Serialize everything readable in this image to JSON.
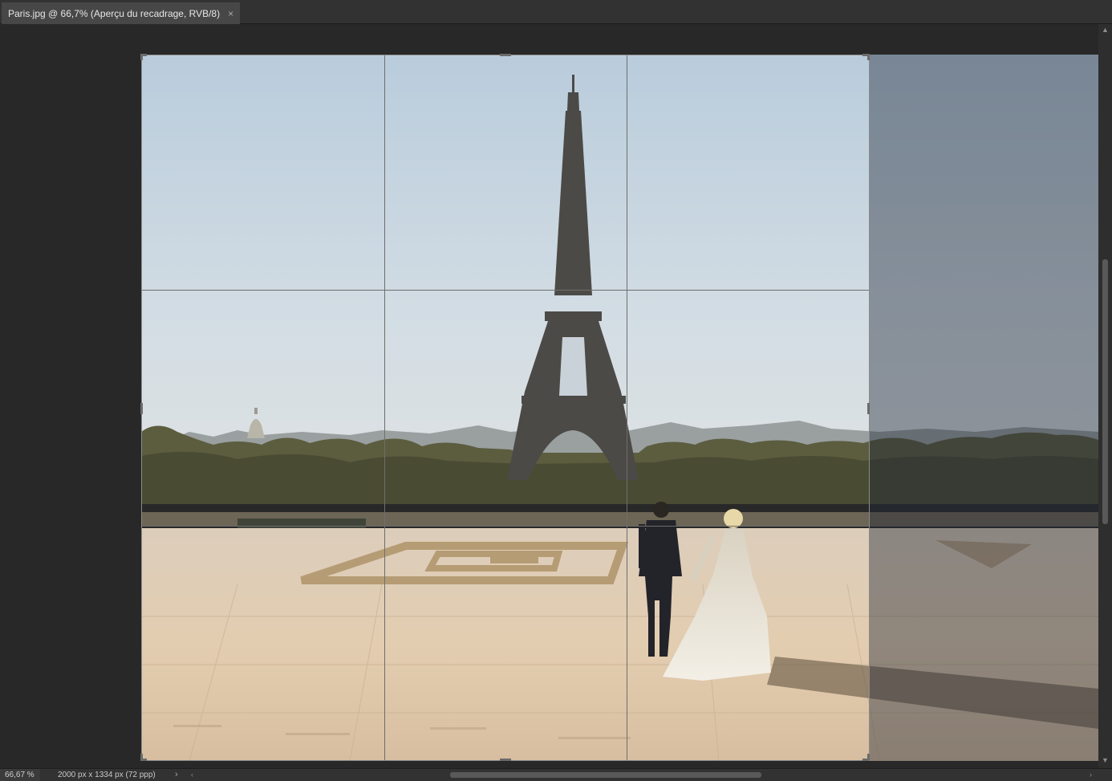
{
  "document_tab": {
    "title": "Paris.jpg @ 66,7% (Aperçu du recadrage, RVB/8)",
    "close_glyph": "×"
  },
  "status": {
    "zoom": "66,67 %",
    "doc_info": "2000 px x 1334 px (72 ppp)",
    "info_arrow": "›"
  },
  "scrollbars": {
    "up_arrow": "▲",
    "down_arrow": "▼",
    "left_arrow": "‹",
    "right_arrow": "›"
  },
  "colors": {
    "app_background": "#282828",
    "tab_active": "#474747",
    "crop_guides": "#6e6e6e",
    "outside_crop_shade": "rgba(30,38,52,0.42)"
  }
}
